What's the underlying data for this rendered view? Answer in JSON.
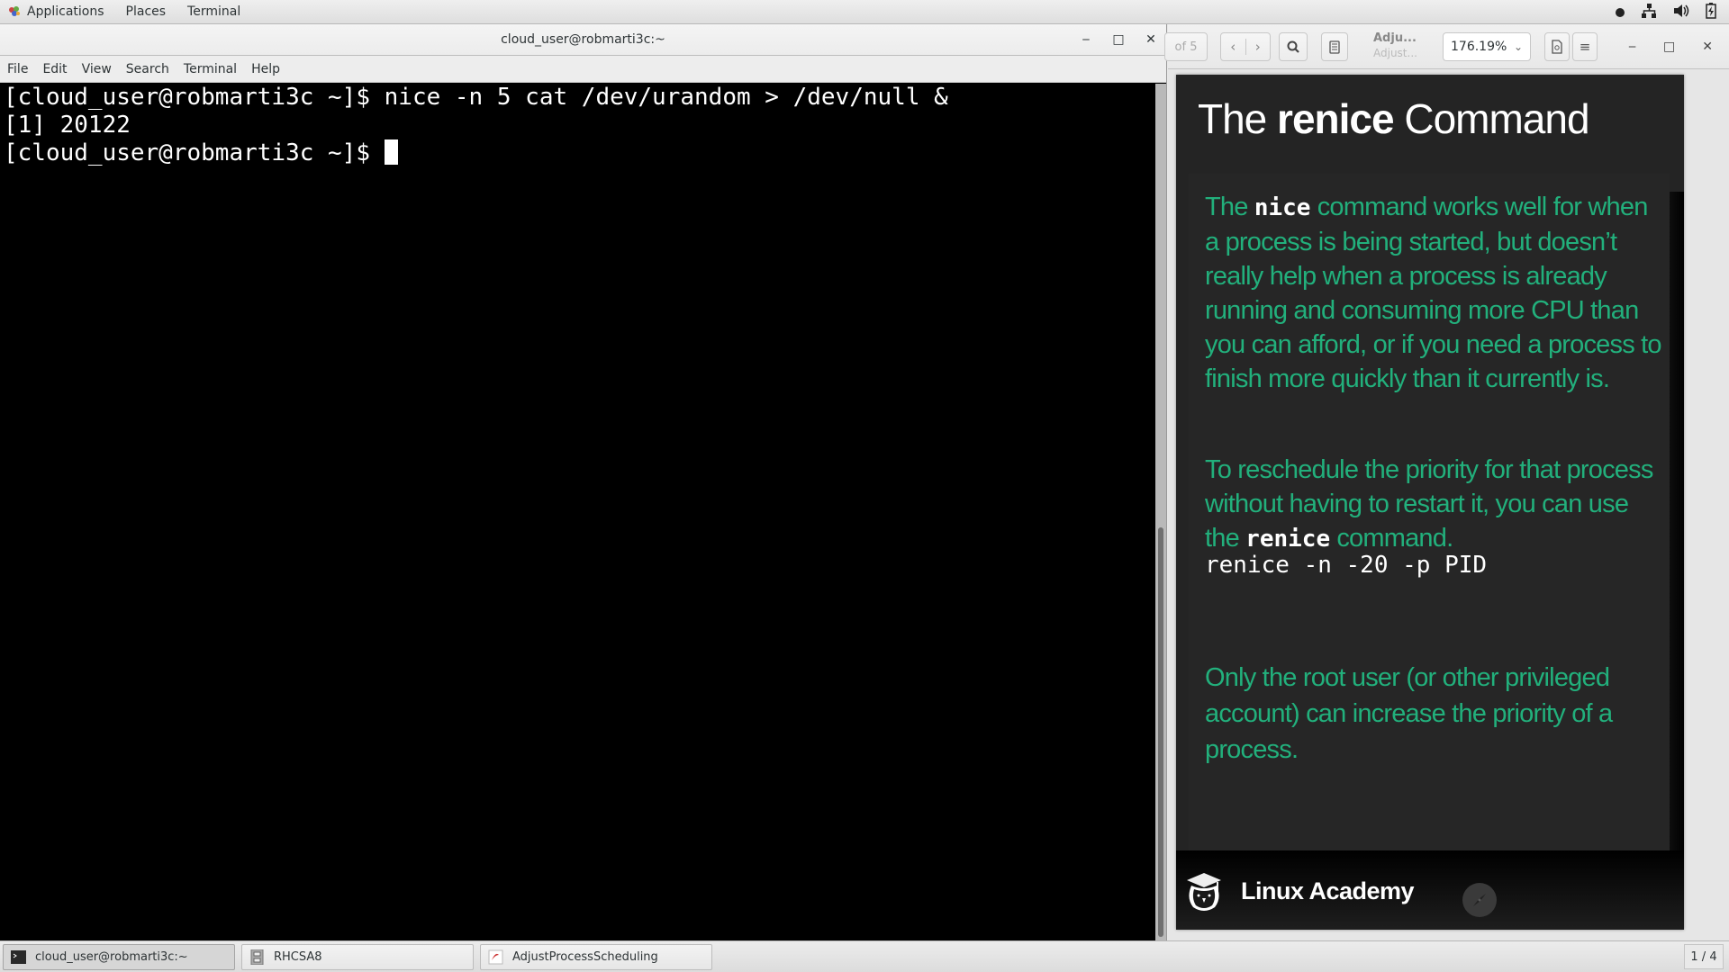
{
  "top_panel": {
    "menus": [
      "Applications",
      "Places",
      "Terminal"
    ],
    "tray_icons": [
      "record-dot-icon",
      "network-icon",
      "volume-icon",
      "battery-icon"
    ]
  },
  "terminal": {
    "title": "cloud_user@robmarti3c:~",
    "menu": [
      "File",
      "Edit",
      "View",
      "Search",
      "Terminal",
      "Help"
    ],
    "lines": [
      "[cloud_user@robmarti3c ~]$ nice -n 5 cat /dev/urandom > /dev/null &",
      "[1] 20122",
      "[cloud_user@robmarti3c ~]$ "
    ]
  },
  "viewer": {
    "page_entry": "of 5",
    "doc_title": "Adju...",
    "doc_subtitle": "Adjust...",
    "zoom_level": "176.19%",
    "slide": {
      "title_pre": "The ",
      "title_bold": "renice",
      "title_post": " Command",
      "p1_pre": "The ",
      "p1_code": "nice",
      "p1_post": " command works well for when a process is being started, but doesn’t really help when a process is already running and consuming more CPU than you can afford, or if you need a process to finish more quickly than it currently is.",
      "p2_pre": "To reschedule the priority for that process without having to restart it, you can use the ",
      "p2_code": "renice",
      "p2_post": " command.",
      "command": "renice -n -20 -p PID",
      "p3": "Only the root user (or other privileged account) can increase the priority of a process.",
      "brand": "Linux Academy"
    }
  },
  "taskbar": {
    "tasks": [
      "cloud_user@robmarti3c:~",
      "RHCSA8",
      "AdjustProcessScheduling"
    ],
    "workspace": "1 / 4"
  },
  "colors": {
    "slide_text": "#22b07c",
    "slide_bg": "#242424",
    "terminal_bg": "#000000"
  }
}
